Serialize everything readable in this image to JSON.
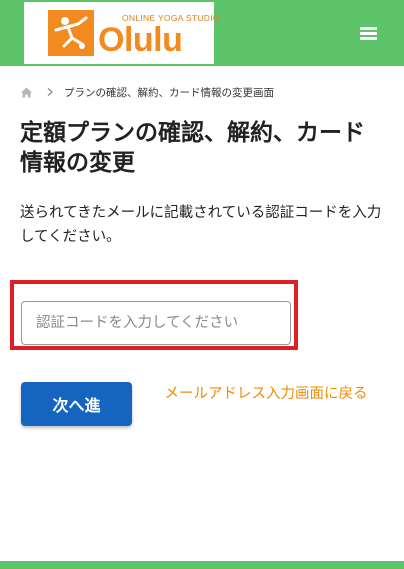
{
  "header": {
    "logo_subtitle": "ONLINE YOGA STUDIO",
    "logo_name": "Olulu",
    "brand_color": "#5dc46a",
    "logo_color": "#f28a1e",
    "menu_icon": "hamburger-menu-icon"
  },
  "breadcrumb": {
    "home_icon": "home-icon",
    "separator_icon": "chevron-right-icon",
    "current": "プランの確認、解約、カード情報の変更画面"
  },
  "main": {
    "title": "定額プランの確認、解約、カード情報の変更",
    "description": "送られてきたメールに記載されている認証コードを入力してください。",
    "code_input": {
      "placeholder": "認証コードを入力してください",
      "value": ""
    },
    "highlight_color": "#e01e25",
    "next_button_label": "次へ進",
    "next_button_color": "#1565c0",
    "back_link_label": "メールアドレス入力画面に戻る",
    "back_link_color": "#f08c00"
  }
}
